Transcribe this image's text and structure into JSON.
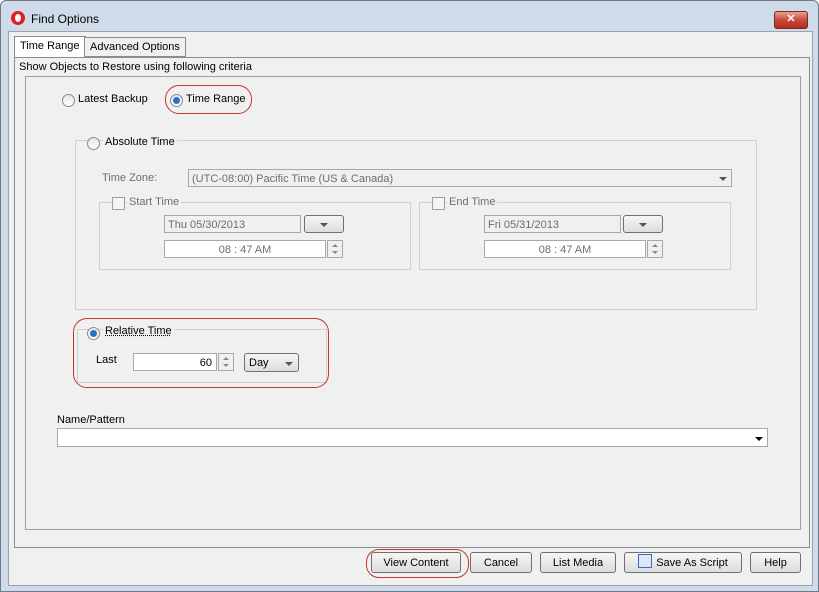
{
  "window": {
    "title": "Find Options",
    "close_label": "✕"
  },
  "tabs": [
    {
      "label": "Time Range",
      "active": true
    },
    {
      "label": "Advanced Options",
      "active": false
    }
  ],
  "criteria_label": "Show Objects to Restore using following criteria",
  "mode": {
    "latest_backup": {
      "label": "Latest Backup",
      "selected": false
    },
    "time_range": {
      "label": "Time Range",
      "selected": true
    }
  },
  "absolute": {
    "label": "Absolute Time",
    "selected": false,
    "time_zone_label": "Time Zone:",
    "time_zone_value": "(UTC-08:00) Pacific Time (US & Canada)",
    "start": {
      "label": "Start Time",
      "date": "Thu 05/30/2013",
      "time": "08 : 47 AM"
    },
    "end": {
      "label": "End Time",
      "date": "Fri 05/31/2013",
      "time": "08 : 47 AM"
    }
  },
  "relative": {
    "label": "Relative Time",
    "selected": true,
    "last_label": "Last",
    "value": "60",
    "unit": "Day"
  },
  "name_pattern": {
    "label": "Name/Pattern",
    "value": ""
  },
  "buttons": {
    "view_content": "View Content",
    "cancel": "Cancel",
    "list_media": "List Media",
    "save_as_script": "Save As Script",
    "help": "Help"
  },
  "colors": {
    "highlight": "#c0392b",
    "radio_selected": "#2a6fc7"
  }
}
